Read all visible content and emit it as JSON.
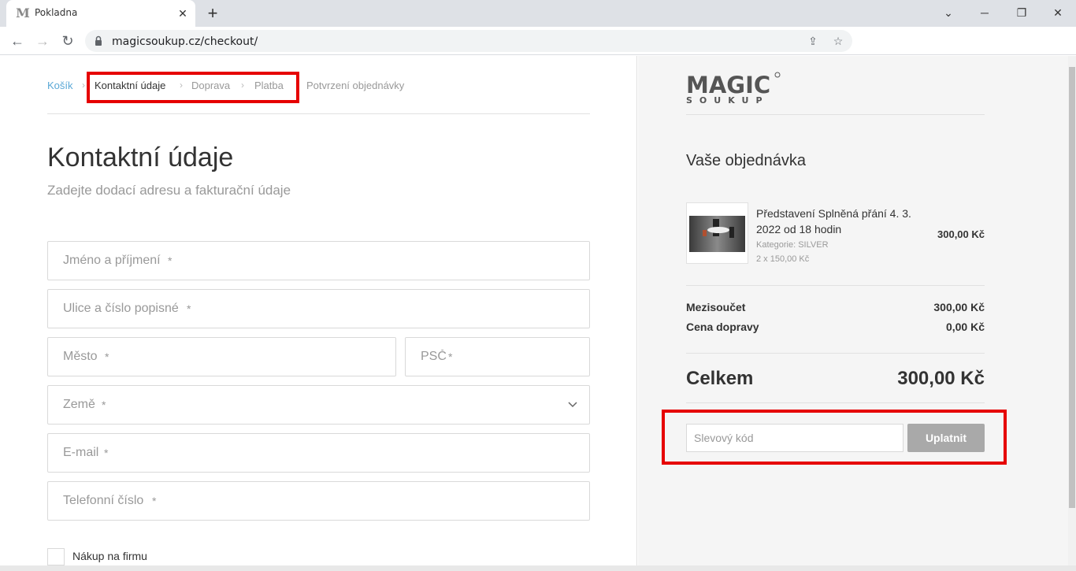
{
  "browser": {
    "tab_title": "Pokladna",
    "tab_favicon": "M",
    "url": "magicsoukup.cz/checkout/"
  },
  "breadcrumb": {
    "items": [
      "Košík",
      "Kontaktní údaje",
      "Doprava",
      "Platba",
      "Potvrzení objednávky"
    ],
    "separator": "›",
    "active_index": 1,
    "link_color": "#5aa8d6"
  },
  "form": {
    "title": "Kontaktní údaje",
    "subtitle": "Zadejte dodací adresu a fakturační údaje",
    "fields": {
      "name": "Jméno a příjmení",
      "street": "Ulice a číslo popisné",
      "city": "Město",
      "zip": "PSČ",
      "country": "Země",
      "email": "E-mail",
      "phone": "Telefonní číslo"
    },
    "required_mark": "*",
    "company_checkbox": "Nákup na firmu"
  },
  "order": {
    "logo_text": "MAGIC",
    "logo_sub": "SOUKUP",
    "title": "Vaše objednávka",
    "product": {
      "name": "Představení Splněná přání 4. 3. 2022 od 18 hodin",
      "category": "Kategorie: SILVER",
      "quantity": "2 x 150,00 Kč",
      "price": "300,00 Kč"
    },
    "subtotal_label": "Mezisoučet",
    "subtotal_value": "300,00 Kč",
    "shipping_label": "Cena dopravy",
    "shipping_value": "0,00 Kč",
    "total_label": "Celkem",
    "total_value": "300,00 Kč",
    "coupon_placeholder": "Slevový kód",
    "apply_label": "Uplatnit"
  },
  "highlight_color": "#e60000"
}
